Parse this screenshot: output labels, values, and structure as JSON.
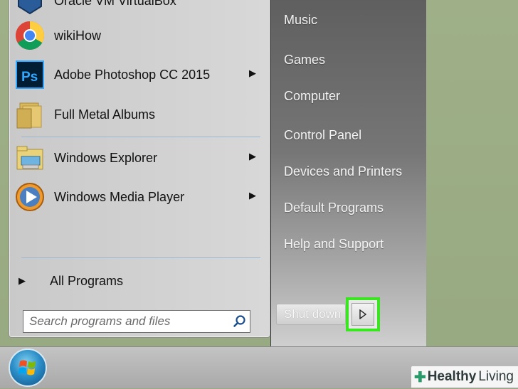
{
  "start_menu": {
    "partial_top_item": "Oracle VM VirtualBox",
    "programs": [
      {
        "label": "wikiHow",
        "icon": "chrome-icon",
        "has_submenu": false
      },
      {
        "label": "Adobe Photoshop CC 2015",
        "icon": "photoshop-icon",
        "has_submenu": true
      },
      {
        "label": "Full Metal Albums",
        "icon": "folder-icon",
        "has_submenu": false
      },
      {
        "label": "Windows Explorer",
        "icon": "windows-explorer-icon",
        "has_submenu": true
      },
      {
        "label": "Windows Media Player",
        "icon": "media-player-icon",
        "has_submenu": true
      }
    ],
    "all_programs": "All Programs",
    "search_placeholder": "Search programs and files",
    "right_items": [
      "Music",
      "Games",
      "Computer",
      "Control Panel",
      "Devices and Printers",
      "Default Programs",
      "Help and Support"
    ],
    "shutdown_label": "Shut down"
  },
  "watermark": {
    "brand": "Healthy",
    "brand2": "Living"
  },
  "colors": {
    "highlight": "#39e61f",
    "desktop": "#9aab84"
  }
}
